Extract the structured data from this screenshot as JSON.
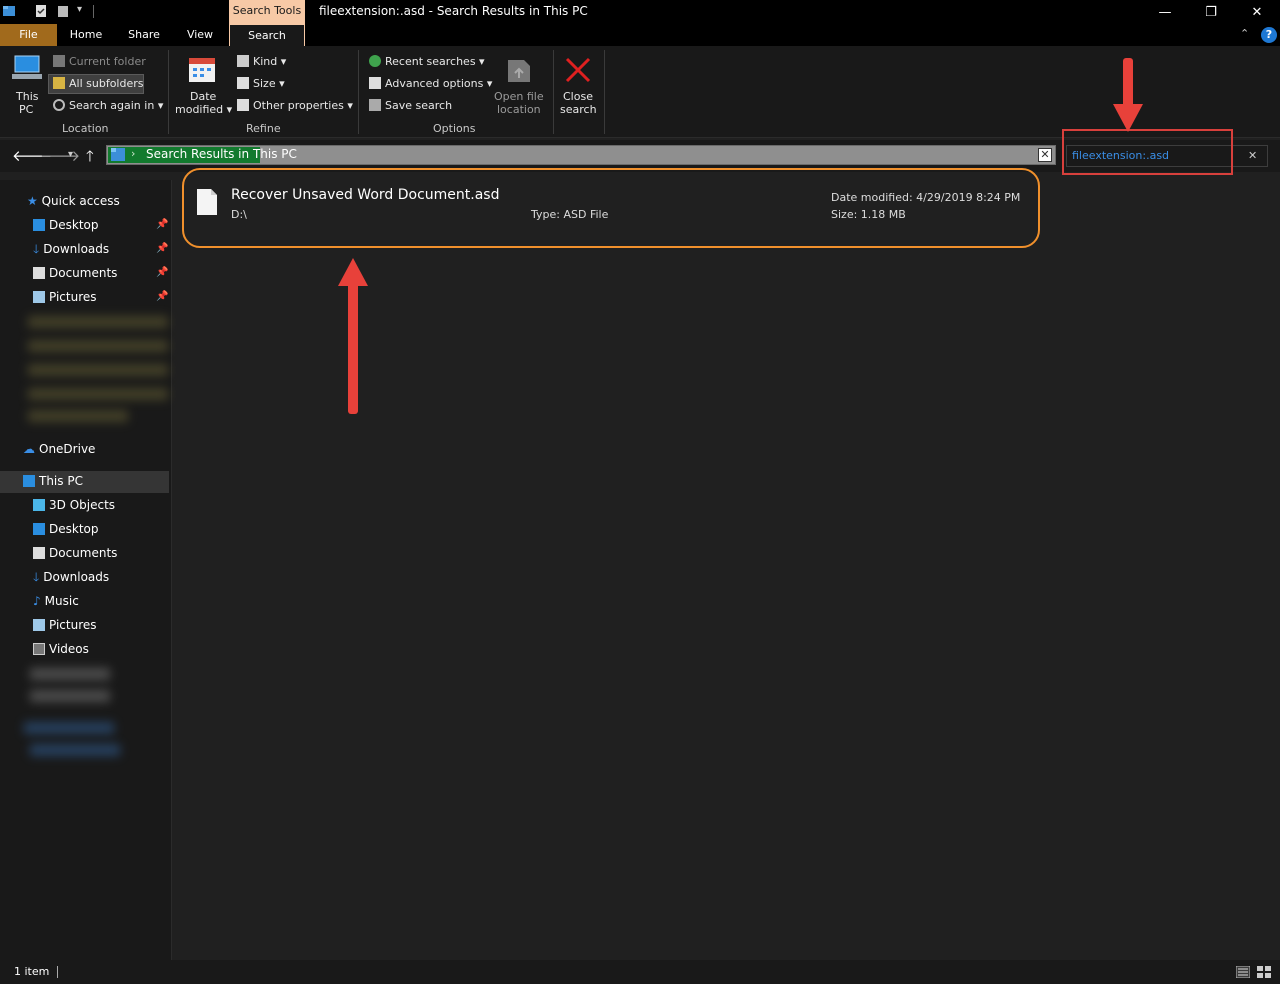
{
  "window": {
    "title": "fileextension:.asd - Search Results in This PC",
    "context_tab": "Search Tools",
    "minimize": "—",
    "restore": "❐",
    "close": "✕"
  },
  "tabs": [
    "File",
    "Home",
    "Share",
    "View",
    "Search"
  ],
  "ribbon": {
    "location": {
      "this_pc": [
        "This",
        "PC"
      ],
      "current_folder": "Current folder",
      "all_subfolders": "All subfolders",
      "search_again": "Search again in",
      "label": "Location"
    },
    "refine": {
      "date_modified": [
        "Date",
        "modified"
      ],
      "kind": "Kind",
      "size": "Size",
      "other_properties": "Other properties",
      "label": "Refine"
    },
    "options": {
      "recent_searches": "Recent searches",
      "advanced_options": "Advanced options",
      "save_search": "Save search",
      "open_file_location": [
        "Open file",
        "location"
      ],
      "label": "Options"
    },
    "close_search": [
      "Close",
      "search"
    ]
  },
  "address": {
    "path": "Search Results in This PC"
  },
  "search": {
    "value": "fileextension:.asd",
    "clear": "✕"
  },
  "sidebar": {
    "quick_access": "Quick access",
    "quick_items": [
      "Desktop",
      "Downloads",
      "Documents",
      "Pictures"
    ],
    "onedrive": "OneDrive",
    "this_pc": "This PC",
    "pc_items": [
      "3D Objects",
      "Desktop",
      "Documents",
      "Downloads",
      "Music",
      "Pictures",
      "Videos"
    ]
  },
  "result": {
    "name": "Recover Unsaved Word Document.asd",
    "location": "D:\\",
    "type_label": "Type:",
    "type_value": "ASD File",
    "date_label": "Date modified:",
    "date_value": "4/29/2019 8:24 PM",
    "size_label": "Size:",
    "size_value": "1.18 MB"
  },
  "status": {
    "count": "1 item"
  },
  "colors": {
    "accent_red": "#e8413a",
    "highlight_orange": "#f0902c",
    "file_tab": "#a16a1c",
    "search_tools": "#f7c9a6"
  }
}
